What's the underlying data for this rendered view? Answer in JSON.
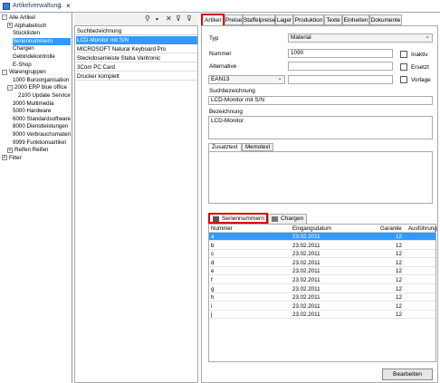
{
  "window": {
    "title": "Artikelverwaltung",
    "pin_icon": "pin-icon",
    "close_icon": "close-icon"
  },
  "tree": {
    "items": [
      {
        "label": "Alle Artikel",
        "expander": "-",
        "indent": 0
      },
      {
        "label": "Alphabetisch",
        "expander": "+",
        "indent": 1
      },
      {
        "label": "Stücklisten",
        "expander": "",
        "indent": 2
      },
      {
        "label": "Seriennummern",
        "expander": "",
        "indent": 2,
        "selected": true
      },
      {
        "label": "Chargen",
        "expander": "",
        "indent": 2
      },
      {
        "label": "Gebindekontrolle",
        "expander": "",
        "indent": 2
      },
      {
        "label": "E-Shop",
        "expander": "",
        "indent": 2
      },
      {
        "label": "Warengruppen",
        "expander": "-",
        "indent": 0
      },
      {
        "label": "1000 Buroorganisation",
        "expander": "",
        "indent": 2
      },
      {
        "label": "2000 ERP blue office",
        "expander": "-",
        "indent": 1
      },
      {
        "label": "2100 Update Service",
        "expander": "",
        "indent": 3
      },
      {
        "label": "3000 Multimedia",
        "expander": "",
        "indent": 2
      },
      {
        "label": "5000 Hardware",
        "expander": "",
        "indent": 2
      },
      {
        "label": "6000 Standardsoftware",
        "expander": "",
        "indent": 2
      },
      {
        "label": "8000 Dienstleistungen",
        "expander": "",
        "indent": 2
      },
      {
        "label": "9000 Verbrauchsmaterial",
        "expander": "",
        "indent": 2
      },
      {
        "label": "9999 Funktionsartikel",
        "expander": "",
        "indent": 2
      },
      {
        "label": "Reifen Reifen",
        "expander": "+",
        "indent": 1
      },
      {
        "label": "Filter",
        "expander": "+",
        "indent": 0
      }
    ]
  },
  "list": {
    "toolbar_icons": [
      "search-icon",
      "dropdown-icon",
      "clear-icon",
      "funnel-icon",
      "funnel-clear-icon"
    ],
    "header": "Suchbezeichnung",
    "rows": [
      {
        "label": "LCD-Monitor mit S/N",
        "selected": true
      },
      {
        "label": "MICROSOFT Natural Keyboard Pro"
      },
      {
        "label": "Steckdosenleiste Steba Varitronic"
      },
      {
        "label": "3Com PC Card"
      },
      {
        "label": "Drucker komplett"
      }
    ]
  },
  "tabs": [
    "Artikel",
    "Preise",
    "Staffelpreise",
    "Lager",
    "Produktion",
    "Texte",
    "Einheiten",
    "Dokumente"
  ],
  "form": {
    "typ_label": "Typ",
    "typ_value": "Material",
    "nummer_label": "Nummer",
    "nummer_value": "1090",
    "inaktiv_label": "Inaktiv",
    "alternative_label": "Alternative",
    "alternative_value": "",
    "ersetzt_label": "Ersetzt",
    "ean_select": "EAN13",
    "ean_value": "",
    "vorlage_label": "Vorlage",
    "suchbez_label": "Suchbezeichnung",
    "suchbez_value": "LCD-Monitor mit S/N",
    "bez_label": "Bezeichnung",
    "bez_value": "LCD-Monitor",
    "text_tabs": [
      "Zusatztext",
      "Memotext"
    ]
  },
  "bottom_tabs": {
    "seriennummern": "Seriennummern",
    "chargen": "Chargen"
  },
  "serial_grid": {
    "columns": [
      "Nummer",
      "Eingangsdatum",
      "Garantie",
      "Ausführung"
    ],
    "rows": [
      {
        "nummer": "a",
        "datum": "23.02.2011",
        "garantie": "12",
        "selected": true
      },
      {
        "nummer": "b",
        "datum": "23.02.2011",
        "garantie": "12"
      },
      {
        "nummer": "c",
        "datum": "23.02.2011",
        "garantie": "12"
      },
      {
        "nummer": "d",
        "datum": "23.02.2011",
        "garantie": "12"
      },
      {
        "nummer": "e",
        "datum": "23.02.2011",
        "garantie": "12"
      },
      {
        "nummer": "f",
        "datum": "23.02.2011",
        "garantie": "12"
      },
      {
        "nummer": "g",
        "datum": "23.02.2011",
        "garantie": "12"
      },
      {
        "nummer": "h",
        "datum": "23.02.2011",
        "garantie": "12"
      },
      {
        "nummer": "i",
        "datum": "23.02.2011",
        "garantie": "12"
      },
      {
        "nummer": "j",
        "datum": "23.02.2011",
        "garantie": "12"
      }
    ]
  },
  "buttons": {
    "bearbeiten": "Bearbeiten"
  }
}
